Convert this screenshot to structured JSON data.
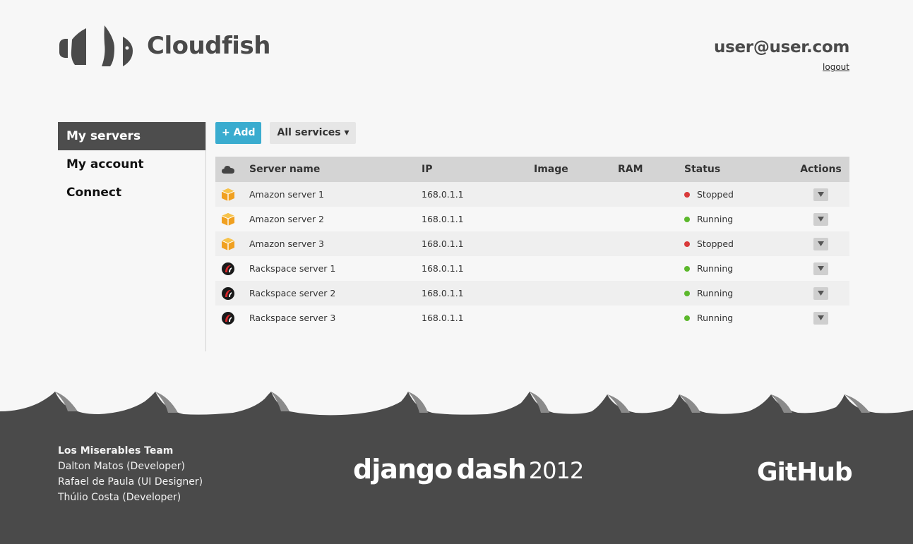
{
  "brand": {
    "name": "Cloudfish"
  },
  "user": {
    "email": "user@user.com",
    "logout_label": "logout"
  },
  "sidebar": {
    "items": [
      {
        "label": "My servers"
      },
      {
        "label": "My account"
      },
      {
        "label": "Connect"
      }
    ]
  },
  "toolbar": {
    "add_label": "+ Add",
    "filter_label": "All services ▾"
  },
  "table": {
    "headers": {
      "name": "Server name",
      "ip": "IP",
      "image": "Image",
      "ram": "RAM",
      "status": "Status",
      "actions": "Actions"
    },
    "rows": [
      {
        "provider_icon": "amazon-box-icon",
        "name": "Amazon server 1",
        "ip": "168.0.1.1",
        "image": "",
        "ram": "",
        "status": "Stopped",
        "status_color": "#d93a3a"
      },
      {
        "provider_icon": "amazon-box-icon",
        "name": "Amazon server 2",
        "ip": "168.0.1.1",
        "image": "",
        "ram": "",
        "status": "Running",
        "status_color": "#5cb82c"
      },
      {
        "provider_icon": "amazon-box-icon",
        "name": "Amazon server 3",
        "ip": "168.0.1.1",
        "image": "",
        "ram": "",
        "status": "Stopped",
        "status_color": "#d93a3a"
      },
      {
        "provider_icon": "rackspace-icon",
        "name": "Rackspace server 1",
        "ip": "168.0.1.1",
        "image": "",
        "ram": "",
        "status": "Running",
        "status_color": "#5cb82c"
      },
      {
        "provider_icon": "rackspace-icon",
        "name": "Rackspace server 2",
        "ip": "168.0.1.1",
        "image": "",
        "ram": "",
        "status": "Running",
        "status_color": "#5cb82c"
      },
      {
        "provider_icon": "rackspace-icon",
        "name": "Rackspace server 3",
        "ip": "168.0.1.1",
        "image": "",
        "ram": "",
        "status": "Running",
        "status_color": "#5cb82c"
      }
    ]
  },
  "footer": {
    "team_title": "Los Miserables Team",
    "members": [
      "Dalton Matos (Developer)",
      "Rafael de Paula (UI Designer)",
      "Thúlio Costa (Developer)"
    ],
    "dash_word1": "django",
    "dash_word2": "dash",
    "dash_year": "2012",
    "github_label": "GitHub"
  },
  "colors": {
    "accent": "#3aaccf",
    "dark": "#4a4a4a",
    "running": "#5cb82c",
    "stopped": "#d93a3a"
  }
}
